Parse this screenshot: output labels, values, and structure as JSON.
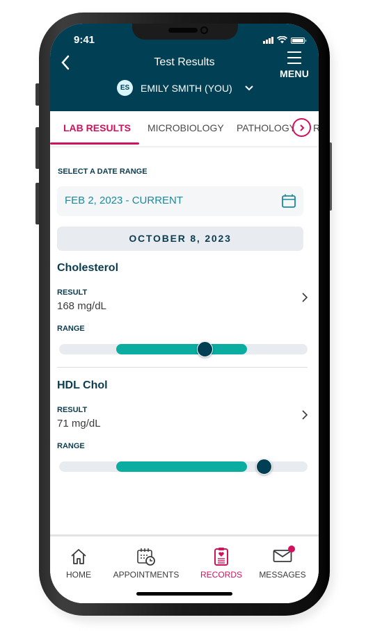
{
  "status_bar": {
    "time": "9:41"
  },
  "header": {
    "title": "Test Results",
    "back_icon": "chevron-left-icon",
    "menu_label": "MENU",
    "menu_icon": "hamburger-icon",
    "user": {
      "initials": "ES",
      "name": "EMILY SMITH (YOU)",
      "dropdown_icon": "chevron-down-icon"
    }
  },
  "tabs": {
    "items": [
      {
        "label": "LAB RESULTS",
        "active": true
      },
      {
        "label": "MICROBIOLOGY",
        "active": false
      },
      {
        "label": "PATHOLOGY",
        "active": false
      },
      {
        "label": "R",
        "active": false
      }
    ],
    "next_icon": "chevron-right-circle-icon"
  },
  "date_range": {
    "label": "SELECT A DATE RANGE",
    "value": "FEB 2, 2023 - CURRENT",
    "icon": "calendar-icon"
  },
  "date_banner": "OCTOBER 8, 2023",
  "results": [
    {
      "name": "Cholesterol",
      "result_label": "RESULT",
      "result_value": "168 mg/dL",
      "range_label": "RANGE",
      "range": {
        "normal_start": 0.23,
        "normal_end": 0.756,
        "value_position": 0.588
      }
    },
    {
      "name": "HDL Chol",
      "result_label": "RESULT",
      "result_value": "71 mg/dL",
      "range_label": "RANGE",
      "range": {
        "normal_start": 0.23,
        "normal_end": 0.756,
        "value_position": 0.824
      }
    }
  ],
  "bottom_nav": {
    "items": [
      {
        "label": "HOME",
        "icon": "home-icon",
        "active": false
      },
      {
        "label": "APPOINTMENTS",
        "icon": "calendar-clock-icon",
        "active": false
      },
      {
        "label": "RECORDS",
        "icon": "clipboard-heart-icon",
        "active": true
      },
      {
        "label": "MESSAGES",
        "icon": "envelope-icon",
        "active": false,
        "has_badge": true
      }
    ]
  },
  "colors": {
    "header_bg": "#003f54",
    "accent": "#d0115e",
    "teal": "#0aada0",
    "date_text": "#1a8a9b"
  }
}
